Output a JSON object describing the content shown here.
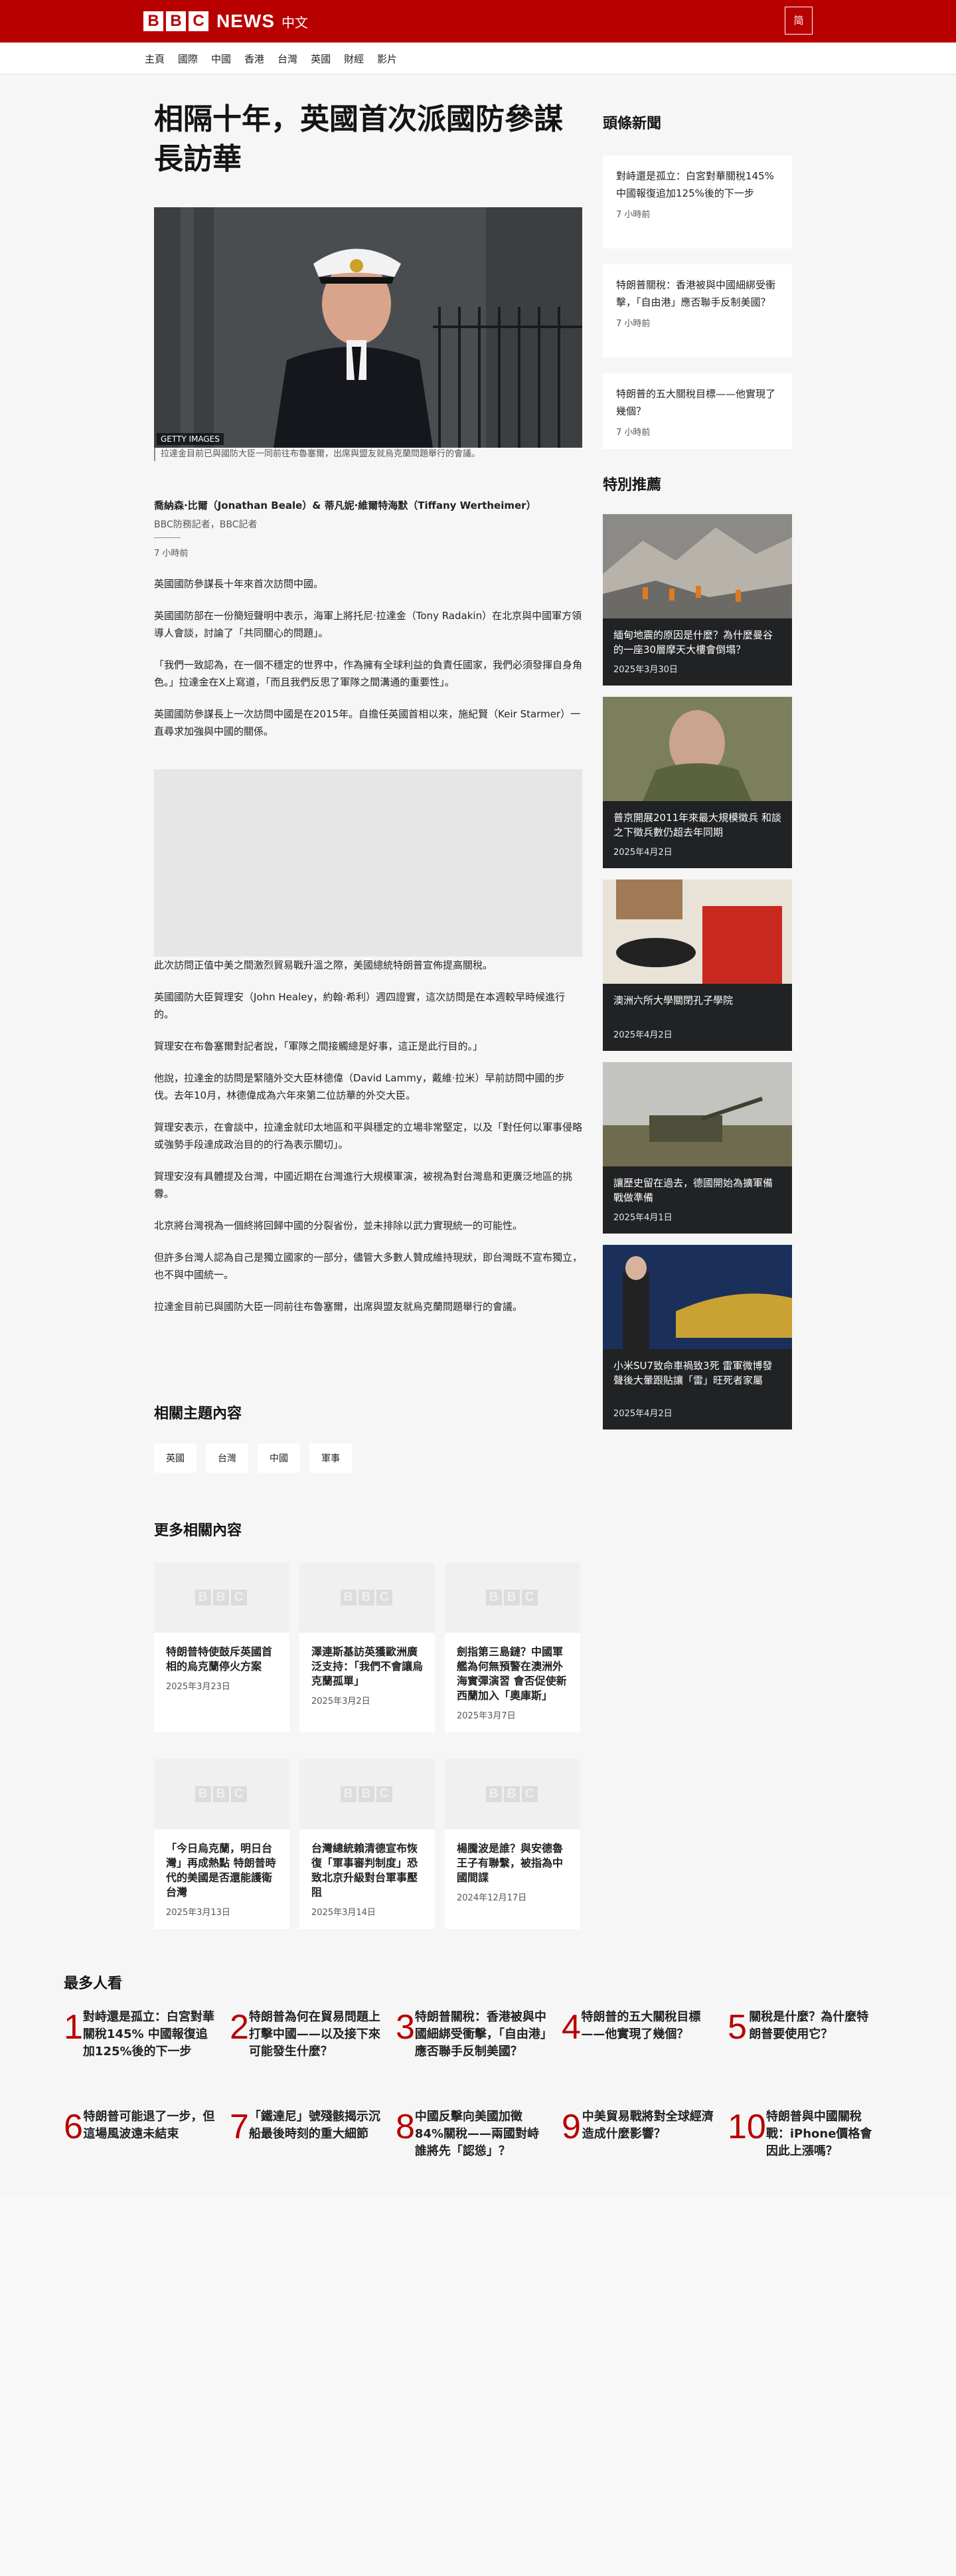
{
  "header": {
    "logo_letters": [
      "B",
      "B",
      "C"
    ],
    "news_label": "NEWS",
    "zh_label": "中文",
    "lang_toggle": "简",
    "brand_color": "#b80000"
  },
  "nav": {
    "items": [
      "主頁",
      "國際",
      "中國",
      "香港",
      "台灣",
      "英國",
      "財經",
      "影片"
    ]
  },
  "article": {
    "headline": "相隔十年，英國首次派國防參謀長訪華",
    "image_credit": "GETTY IMAGES",
    "caption": "拉達金目前已與國防大臣一同前往布魯塞爾，出席與盟友就烏克蘭問題舉行的會議。",
    "byline_names": "喬納森·比爾（Jonathan Beale）& 蒂凡妮·維爾特海默（Tiffany Wertheimer）",
    "byline_roles": "BBC防務記者，BBC記者",
    "time": "7 小時前",
    "paragraphs_a": [
      "英國國防參謀長十年來首次訪問中國。",
      "英國國防部在一份簡短聲明中表示，海軍上將托尼·拉達金（Tony Radakin）在北京與中國軍方領導人會談，討論了「共同關心的問題」。",
      "「我們一致認為，在一個不穩定的世界中，作為擁有全球利益的負責任國家，我們必須發揮自身角色。」拉達金在X上寫道，「而且我們反思了軍隊之間溝通的重要性」。",
      "英國國防參謀長上一次訪問中國是在2015年。自擔任英國首相以來，施紀賢（Keir Starmer）一直尋求加強與中國的關係。"
    ],
    "paragraphs_b": [
      "此次訪問正值中美之間激烈貿易戰升溫之際，美國總統特朗普宣佈提高關稅。",
      "英國國防大臣賀理安（John Healey，約翰·希利）週四證實，這次訪問是在本週較早時候進行的。",
      "賀理安在布魯塞爾對記者說，「軍隊之間接觸總是好事，這正是此行目的。」",
      "他說，拉達金的訪問是緊隨外交大臣林德偉（David Lammy，戴維·拉米）早前訪問中國的步伐。去年10月，林德偉成為六年來第二位訪華的外交大臣。",
      "賀理安表示，在會談中，拉達金就印太地區和平與穩定的立場非常堅定，以及「對任何以軍事侵略或強勢手段達成政治目的的行為表示關切」。",
      "賀理安沒有具體提及台灣，中國近期在台灣進行大規模軍演，被視為對台灣島和更廣泛地區的挑釁。",
      "北京將台灣視為一個終將回歸中國的分裂省份，並未排除以武力實現統一的可能性。",
      "但許多台灣人認為自己是獨立國家的一部分，儘管大多數人贊成維持現狀，即台灣既不宣布獨立，也不與中國統一。",
      "拉達金目前已與國防大臣一同前往布魯塞爾，出席與盟友就烏克蘭問題舉行的會議。"
    ]
  },
  "related_topics": {
    "title": "相關主題內容",
    "tags": [
      "英國",
      "台灣",
      "中國",
      "軍事"
    ]
  },
  "more_related": {
    "title": "更多相關內容",
    "cards": [
      {
        "title": "特朗普特使鼓斥英國首相的烏克蘭停火方案",
        "date": "2025年3月23日"
      },
      {
        "title": "澤連斯基訪英獲歐洲廣泛支持：「我們不會讓烏克蘭孤單」",
        "date": "2025年3月2日"
      },
      {
        "title": "劍指第三島鏈？中國軍艦為何無預警在澳洲外海實彈演習 會否促使新西蘭加入「奧庫斯」",
        "date": "2025年3月7日"
      },
      {
        "title": "「今日烏克蘭，明日台灣」再成熱點 特朗普時代的美國是否還能護衛台灣",
        "date": "2025年3月13日"
      },
      {
        "title": "台灣總統賴清德宣布恢復「軍事審判制度」恐致北京升級對台軍事壓阻",
        "date": "2025年3月14日"
      },
      {
        "title": "楊騰波是誰？與安德魯王子有聯繫，被指為中國間諜",
        "date": "2024年12月17日"
      }
    ]
  },
  "sidebar": {
    "top_news_title": "頭條新聞",
    "top_news": [
      {
        "title": "對峙還是孤立：白宮對華關稅145% 中國報復追加125%後的下一步",
        "time": "7 小時前"
      },
      {
        "title": "特朗普關稅：香港被與中國細綁受衝擊，「自由港」應否聯手反制美國？",
        "time": "7 小時前"
      },
      {
        "title": "特朗普的五大關稅目標——他實現了幾個？",
        "time": "7 小時前"
      }
    ],
    "promo_title": "特別推薦",
    "promos": [
      {
        "title": "緬甸地震的原因是什麼？為什麼曼谷的一座30層摩天大樓會倒塌？",
        "date": "2025年3月30日"
      },
      {
        "title": "普京開展2011年來最大規模徵兵 和談之下徵兵數仍超去年同期",
        "date": "2025年4月2日"
      },
      {
        "title": "澳洲六所大學關閉孔子學院",
        "date": "2025年4月2日"
      },
      {
        "title": "讓歷史留在過去，德國開始為擴軍備戰做準備",
        "date": "2025年4月1日"
      },
      {
        "title": "小米SU7致命車禍致3死 雷軍微博發聲後大暈跟貼讓「雷」旺死者家屬",
        "date": "2025年4月2日"
      }
    ]
  },
  "most_read": {
    "title": "最多人看",
    "items": [
      {
        "n": "1",
        "title": "對峙還是孤立：白宮對華關稅145% 中國報復追加125%後的下一步"
      },
      {
        "n": "2",
        "title": "特朗普為何在貿易問題上打擊中國——以及接下來可能發生什麼？"
      },
      {
        "n": "3",
        "title": "特朗普關稅：香港被與中國細綁受衝擊，「自由港」應否聯手反制美國？"
      },
      {
        "n": "4",
        "title": "特朗普的五大關稅目標——他實現了幾個？"
      },
      {
        "n": "5",
        "title": "關稅是什麼？為什麼特朗普要使用它？"
      },
      {
        "n": "6",
        "title": "特朗普可能退了一步，但這場風波遠未結束"
      },
      {
        "n": "7",
        "title": "「鐵達尼」號殘骸揭示沉船最後時刻的重大細節"
      },
      {
        "n": "8",
        "title": "中國反擊向美國加徵84%關稅——兩國對峙誰將先「認慫」？"
      },
      {
        "n": "9",
        "title": "中美貿易戰將對全球經濟造成什麼影響？"
      },
      {
        "n": "10",
        "title": "特朗普與中國關稅戰：iPhone價格會因此上漲嗎？"
      }
    ]
  }
}
